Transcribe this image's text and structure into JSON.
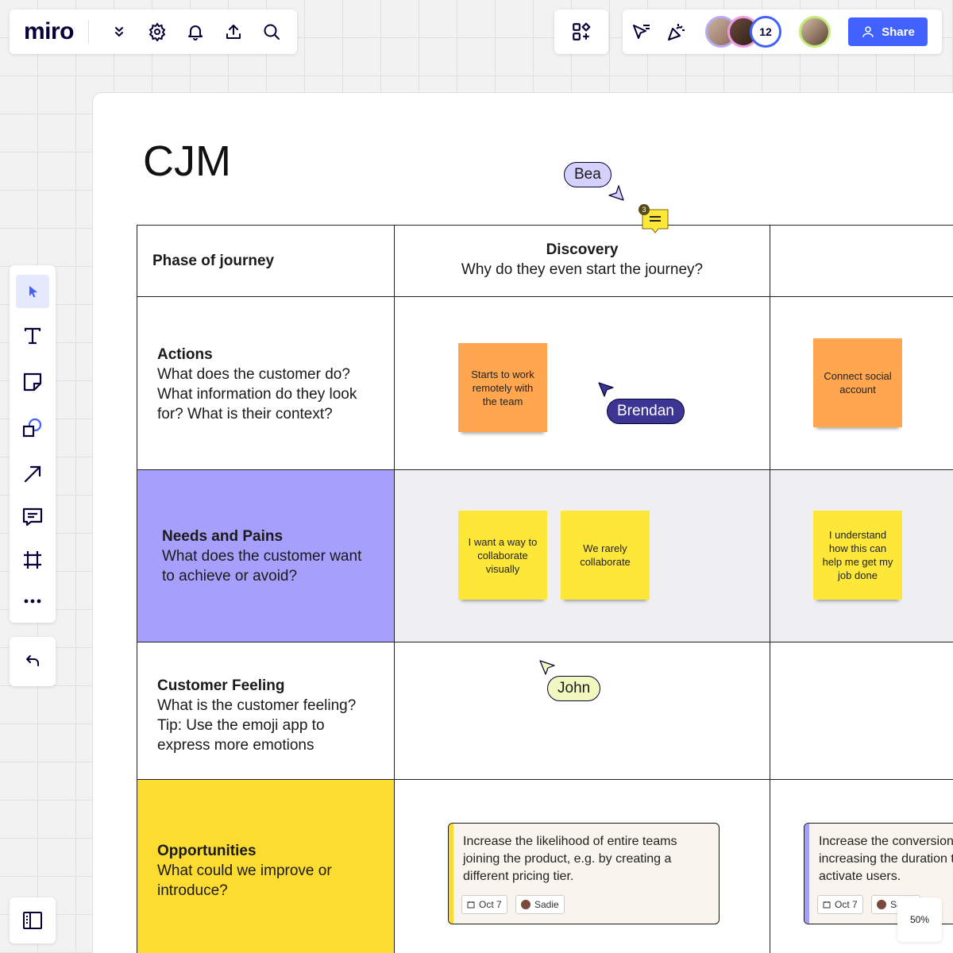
{
  "app": {
    "logo": "miro"
  },
  "topbar": {
    "icons": [
      "chevrons-down-icon",
      "gear-icon",
      "bell-icon",
      "upload-icon",
      "search-icon"
    ],
    "collaborator_count": "12",
    "share_label": "Share"
  },
  "toolbar": {
    "tools": [
      "select-tool-icon",
      "text-tool-icon",
      "sticky-note-tool-icon",
      "shapes-tool-icon",
      "arrow-line-tool-icon",
      "comment-tool-icon",
      "frame-tool-icon",
      "more-tools-icon"
    ]
  },
  "board": {
    "title": "CJM",
    "comment_count": "3",
    "zoom": "50%"
  },
  "table": {
    "phase_header": "Phase of journey",
    "discovery_title": "Discovery",
    "discovery_question": "Why do they even start the journey?",
    "rows": [
      {
        "title": "Actions",
        "desc": "What does the customer do? What information do they look for? What is their context?"
      },
      {
        "title": "Needs and Pains",
        "desc": "What does the customer want to achieve or avoid?"
      },
      {
        "title": "Customer Feeling",
        "desc": "What is the customer feeling? Tip: Use the emoji app to express more emotions"
      },
      {
        "title": "Opportunities",
        "desc": "What could we improve or introduce?"
      }
    ]
  },
  "stickies": {
    "actions_1": "Starts to work remotely with the team",
    "actions_2": "Connect  social account",
    "needs_1": "I want a way to collaborate visually",
    "needs_2": "We rarely collaborate",
    "needs_3": "I understand how this can help me get my job done"
  },
  "cursors": {
    "bea": "Bea",
    "brendan": "Brendan",
    "john": "John"
  },
  "cards": [
    {
      "text": "Increase the likelihood of entire teams joining the product, e.g. by creating a different pricing tier.",
      "date": "Oct 7",
      "assignee": "Sadie"
    },
    {
      "text": "Increase the conversion by increasing the duration to activate users.",
      "date": "Oct 7",
      "assignee": "Sadie"
    }
  ],
  "colors": {
    "accent": "#4262ff",
    "needs_row": "#a79ffc",
    "opportunities_row": "#fddc32",
    "sticky_orange": "#ffa64f",
    "sticky_yellow": "#fde83a"
  }
}
